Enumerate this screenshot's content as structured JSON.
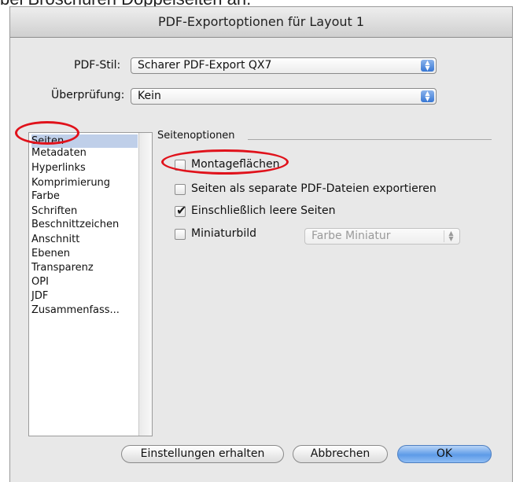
{
  "caption": "bei Broschüren Doppelseiten an.",
  "window": {
    "title": "PDF-Exportoptionen für Layout 1"
  },
  "pdf_style": {
    "label": "PDF-Stil:",
    "value": "Scharer PDF-Export QX7"
  },
  "verification": {
    "label": "Überprüfung:",
    "value": "Kein"
  },
  "sidebar": {
    "items": [
      {
        "label": "Seiten",
        "selected": true
      },
      {
        "label": "Metadaten"
      },
      {
        "label": "Hyperlinks"
      },
      {
        "label": "Komprimierung"
      },
      {
        "label": "Farbe"
      },
      {
        "label": "Schriften"
      },
      {
        "label": "Beschnittzeichen"
      },
      {
        "label": "Anschnitt"
      },
      {
        "label": "Ebenen"
      },
      {
        "label": "Transparenz"
      },
      {
        "label": "OPI"
      },
      {
        "label": "JDF"
      },
      {
        "label": "Zusammenfass..."
      }
    ]
  },
  "page_options": {
    "title": "Seitenoptionen",
    "options": [
      {
        "label": "Montageflächen",
        "checked": false
      },
      {
        "label": "Seiten als separate PDF-Dateien exportieren",
        "checked": false
      },
      {
        "label": "Einschließlich leere Seiten",
        "checked": true
      },
      {
        "label": "Miniaturbild",
        "checked": false
      }
    ],
    "thumbnail_select": {
      "value": "Farbe Miniatur",
      "enabled": false
    }
  },
  "buttons": {
    "keep_settings": "Einstellungen erhalten",
    "cancel": "Abbrechen",
    "ok": "OK"
  },
  "annotation_color": "#e0121b",
  "accent_color": "#5d9be8"
}
